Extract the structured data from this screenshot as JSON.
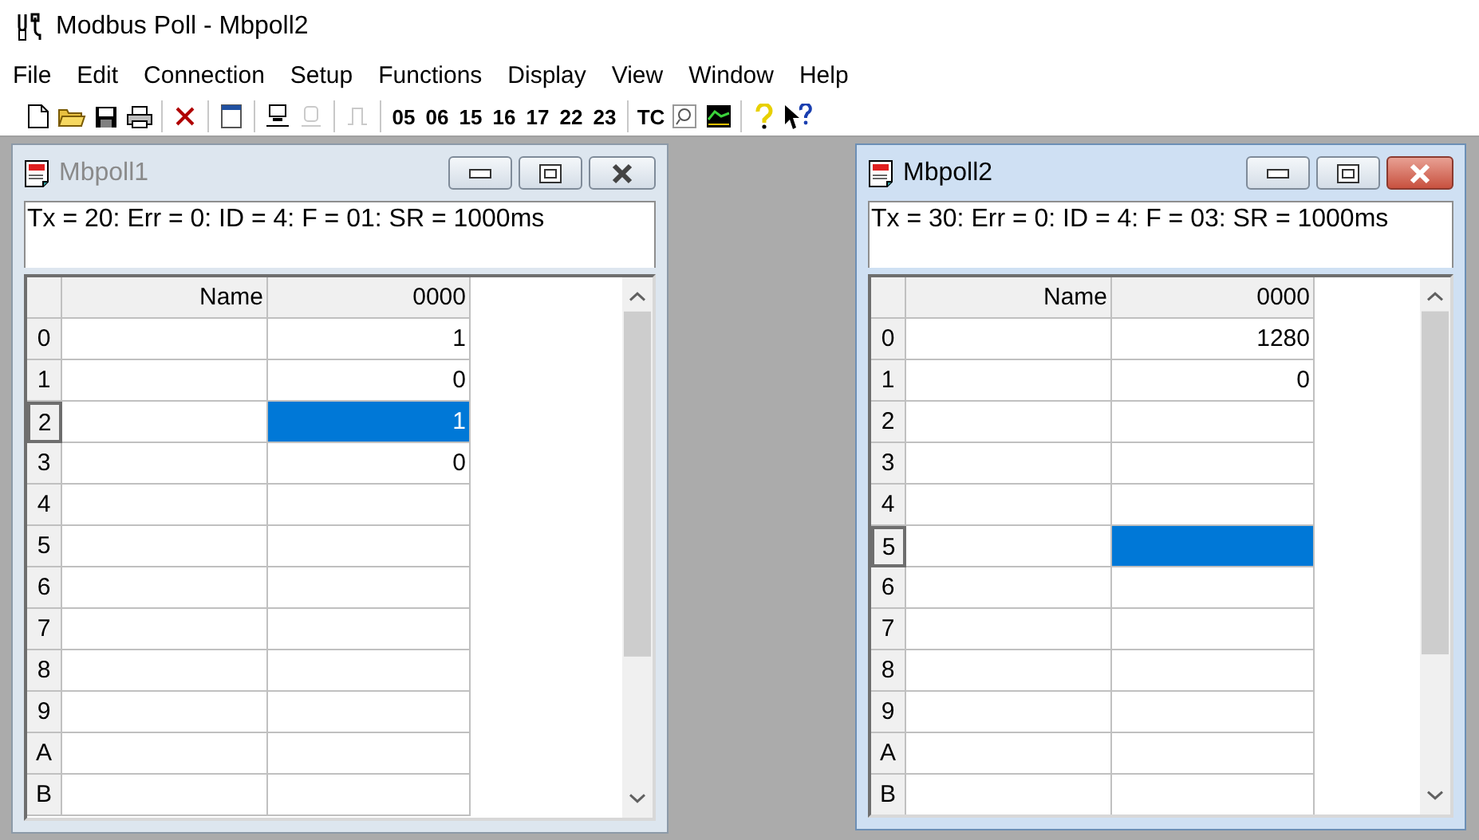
{
  "app": {
    "title": "Modbus Poll - Mbpoll2"
  },
  "menu": [
    "File",
    "Edit",
    "Connection",
    "Setup",
    "Functions",
    "Display",
    "View",
    "Window",
    "Help"
  ],
  "toolbar": [
    [
      {
        "kind": "icon",
        "disabled": false
      },
      {
        "kind": "icon",
        "disabled": false
      },
      {
        "kind": "icon",
        "disabled": false
      },
      {
        "kind": "icon",
        "disabled": false
      }
    ],
    [
      {
        "kind": "icon",
        "disabled": false
      }
    ],
    [
      {
        "kind": "icon",
        "disabled": false
      }
    ],
    [
      {
        "kind": "icon",
        "disabled": false
      },
      {
        "kind": "icon",
        "disabled": true
      }
    ],
    [
      {
        "kind": "icon",
        "disabled": true
      }
    ],
    [
      {
        "kind": "text",
        "label": "05"
      },
      {
        "kind": "text",
        "label": "06"
      },
      {
        "kind": "text",
        "label": "15"
      },
      {
        "kind": "text",
        "label": "16"
      },
      {
        "kind": "text",
        "label": "17"
      },
      {
        "kind": "text",
        "label": "22"
      },
      {
        "kind": "text",
        "label": "23"
      }
    ],
    [
      {
        "kind": "text",
        "label": "TC"
      },
      {
        "kind": "icon",
        "disabled": false
      },
      {
        "kind": "icon",
        "disabled": false
      }
    ],
    [
      {
        "kind": "icon",
        "disabled": false
      },
      {
        "kind": "icon",
        "disabled": false
      }
    ]
  ],
  "windows": [
    {
      "title": "Mbpoll1",
      "active": false,
      "status": "Tx = 20: Err = 0: ID = 4: F = 01: SR = 1000ms",
      "columns": [
        "Name",
        "0000"
      ],
      "rows": [
        {
          "label": "0",
          "name": "",
          "value": "1",
          "selected": false
        },
        {
          "label": "1",
          "name": "",
          "value": "0",
          "selected": false
        },
        {
          "label": "2",
          "name": "",
          "value": "1",
          "selected": true
        },
        {
          "label": "3",
          "name": "",
          "value": "0",
          "selected": false
        },
        {
          "label": "4",
          "name": "",
          "value": "",
          "selected": false
        },
        {
          "label": "5",
          "name": "",
          "value": "",
          "selected": false
        },
        {
          "label": "6",
          "name": "",
          "value": "",
          "selected": false
        },
        {
          "label": "7",
          "name": "",
          "value": "",
          "selected": false
        },
        {
          "label": "8",
          "name": "",
          "value": "",
          "selected": false
        },
        {
          "label": "9",
          "name": "",
          "value": "",
          "selected": false
        },
        {
          "label": "A",
          "name": "",
          "value": "",
          "selected": false
        },
        {
          "label": "B",
          "name": "",
          "value": "",
          "selected": false
        }
      ]
    },
    {
      "title": "Mbpoll2",
      "active": true,
      "status": "Tx = 30: Err = 0: ID = 4: F = 03: SR = 1000ms",
      "columns": [
        "Name",
        "0000"
      ],
      "rows": [
        {
          "label": "0",
          "name": "",
          "value": "1280",
          "selected": false
        },
        {
          "label": "1",
          "name": "",
          "value": "0",
          "selected": false
        },
        {
          "label": "2",
          "name": "",
          "value": "",
          "selected": false
        },
        {
          "label": "3",
          "name": "",
          "value": "",
          "selected": false
        },
        {
          "label": "4",
          "name": "",
          "value": "",
          "selected": false
        },
        {
          "label": "5",
          "name": "",
          "value": "",
          "selected": true
        },
        {
          "label": "6",
          "name": "",
          "value": "",
          "selected": false
        },
        {
          "label": "7",
          "name": "",
          "value": "",
          "selected": false
        },
        {
          "label": "8",
          "name": "",
          "value": "",
          "selected": false
        },
        {
          "label": "9",
          "name": "",
          "value": "",
          "selected": false
        },
        {
          "label": "A",
          "name": "",
          "value": "",
          "selected": false
        },
        {
          "label": "B",
          "name": "",
          "value": "",
          "selected": false
        }
      ]
    }
  ]
}
